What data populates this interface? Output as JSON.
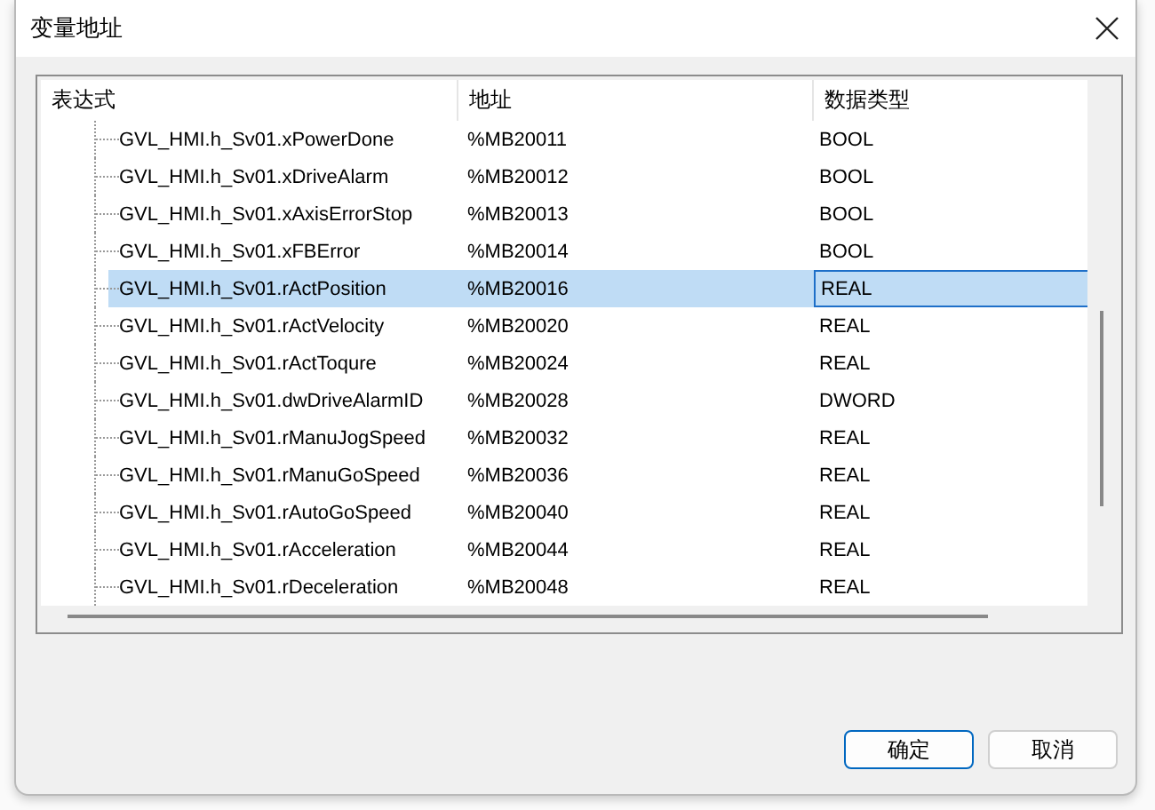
{
  "window": {
    "title": "变量地址"
  },
  "table": {
    "columns": [
      "表达式",
      "地址",
      "数据类型"
    ],
    "rows": [
      {
        "expression": "GVL_HMI.h_Sv01.xPowerDone",
        "address": "%MB20011",
        "type": "BOOL",
        "selected": false
      },
      {
        "expression": "GVL_HMI.h_Sv01.xDriveAlarm",
        "address": "%MB20012",
        "type": "BOOL",
        "selected": false
      },
      {
        "expression": "GVL_HMI.h_Sv01.xAxisErrorStop",
        "address": "%MB20013",
        "type": "BOOL",
        "selected": false
      },
      {
        "expression": "GVL_HMI.h_Sv01.xFBError",
        "address": "%MB20014",
        "type": "BOOL",
        "selected": false
      },
      {
        "expression": "GVL_HMI.h_Sv01.rActPosition",
        "address": "%MB20016",
        "type": "REAL",
        "selected": true
      },
      {
        "expression": "GVL_HMI.h_Sv01.rActVelocity",
        "address": "%MB20020",
        "type": "REAL",
        "selected": false
      },
      {
        "expression": "GVL_HMI.h_Sv01.rActToqure",
        "address": "%MB20024",
        "type": "REAL",
        "selected": false
      },
      {
        "expression": "GVL_HMI.h_Sv01.dwDriveAlarmID",
        "address": "%MB20028",
        "type": "DWORD",
        "selected": false
      },
      {
        "expression": "GVL_HMI.h_Sv01.rManuJogSpeed",
        "address": "%MB20032",
        "type": "REAL",
        "selected": false
      },
      {
        "expression": "GVL_HMI.h_Sv01.rManuGoSpeed",
        "address": "%MB20036",
        "type": "REAL",
        "selected": false
      },
      {
        "expression": "GVL_HMI.h_Sv01.rAutoGoSpeed",
        "address": "%MB20040",
        "type": "REAL",
        "selected": false
      },
      {
        "expression": "GVL_HMI.h_Sv01.rAcceleration",
        "address": "%MB20044",
        "type": "REAL",
        "selected": false
      },
      {
        "expression": "GVL_HMI.h_Sv01.rDeceleration",
        "address": "%MB20048",
        "type": "REAL",
        "selected": false
      }
    ]
  },
  "buttons": [
    {
      "label": "确定",
      "kind": "default"
    },
    {
      "label": "取消",
      "kind": "normal"
    }
  ]
}
